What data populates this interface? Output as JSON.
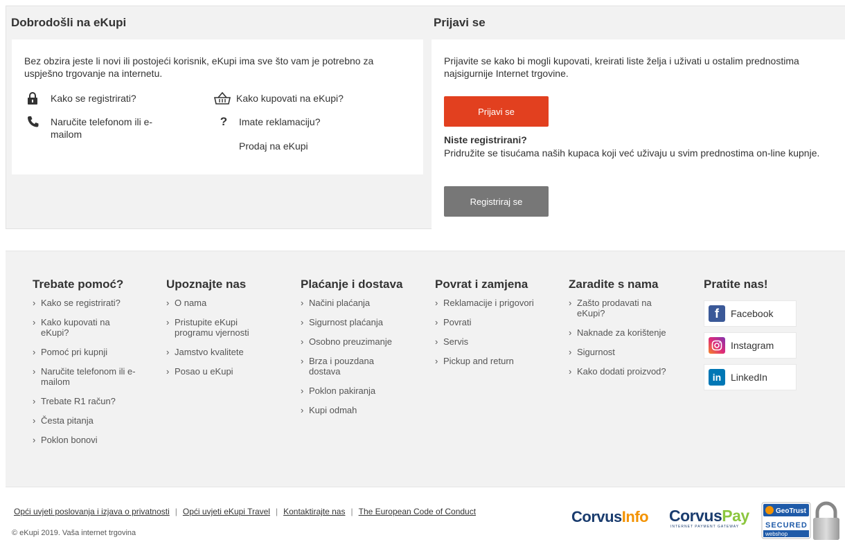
{
  "welcome": {
    "title": "Dobrodošli na eKupi",
    "intro": "Bez obzira jeste li novi ili postojeći korisnik, eKupi ima sve što vam je potrebno za uspješno trgovanje na internetu.",
    "links": [
      {
        "label": "Kako se registrirati?",
        "icon": "lock-icon"
      },
      {
        "label": "Kako kupovati na eKupi?",
        "icon": "basket-icon"
      },
      {
        "label": "Naručite telefonom ili e-mailom",
        "icon": "phone-icon"
      },
      {
        "label": "Imate reklamaciju?",
        "icon": "question-icon"
      },
      {
        "label": "Prodaj na eKupi",
        "icon": ""
      }
    ]
  },
  "login": {
    "title": "Prijavi se",
    "text": "Prijavite se kako bi mogli kupovati, kreirati liste želja i uživati u ostalim prednostima najsigurnije Internet trgovine.",
    "button": "Prijavi se",
    "not_registered": "Niste registrirani?",
    "join_text": "Pridružite se tisućama naših kupaca koji već uživaju u svim prednostima on-line kupnje.",
    "register_button": "Registriraj se"
  },
  "footer": {
    "columns": [
      {
        "title": "Trebate pomoć?",
        "items": [
          "Kako se registrirati?",
          "Kako kupovati na eKupi?",
          "Pomoć pri kupnji",
          "Naručite telefonom ili e-mailom",
          "Trebate R1 račun?",
          "Česta pitanja",
          "Poklon bonovi"
        ]
      },
      {
        "title": "Upoznajte nas",
        "items": [
          "O nama",
          "Pristupite eKupi programu vjernosti",
          "Jamstvo kvalitete",
          "Posao u eKupi"
        ]
      },
      {
        "title": "Plaćanje i dostava",
        "items": [
          "Načini plaćanja",
          "Sigurnost plaćanja",
          "Osobno preuzimanje",
          "Brza i pouzdana dostava",
          "Poklon pakiranja",
          "Kupi odmah"
        ]
      },
      {
        "title": "Povrat i zamjena",
        "items": [
          "Reklamacije i prigovori",
          "Povrati",
          "Servis",
          "Pickup and return"
        ]
      },
      {
        "title": "Zaradite s nama",
        "items": [
          "Zašto prodavati na eKupi?",
          "Naknade za korištenje",
          "Sigurnost",
          "Kako dodati proizvod?"
        ]
      }
    ],
    "social_title": "Pratite nas!",
    "social": [
      {
        "label": "Facebook",
        "icon": "facebook-icon",
        "color": "#3b5998"
      },
      {
        "label": "Instagram",
        "icon": "instagram-icon",
        "color": "#c13584"
      },
      {
        "label": "LinkedIn",
        "icon": "linkedin-icon",
        "color": "#0077b5"
      }
    ]
  },
  "bottom": {
    "links": [
      "Opći uvjeti poslovanja i izjava o privatnosti",
      "Opći uvjeti eKupi Travel",
      "Kontaktirajte nas",
      "The European Code of Conduct"
    ],
    "separator": "|",
    "copyright": "© eKupi 2019. Vaša internet trgovina",
    "logos": {
      "corvus_info": {
        "a": "Corvus",
        "b": "Info"
      },
      "corvus_pay": {
        "a": "Corvus",
        "b": "Pay",
        "sub": "INTERNET PAYMENT GATEWAY"
      },
      "geotrust": {
        "brand": "GeoTrust",
        "secured": "SECURED",
        "webshop": "webshop"
      }
    }
  },
  "colors": {
    "accent": "#e2401f",
    "secondary_button": "#777777",
    "panel_bg": "#f2f2f2",
    "corvus_blue": "#1a3c6e",
    "corvus_orange": "#f39200",
    "corvus_green": "#8cc63f"
  }
}
